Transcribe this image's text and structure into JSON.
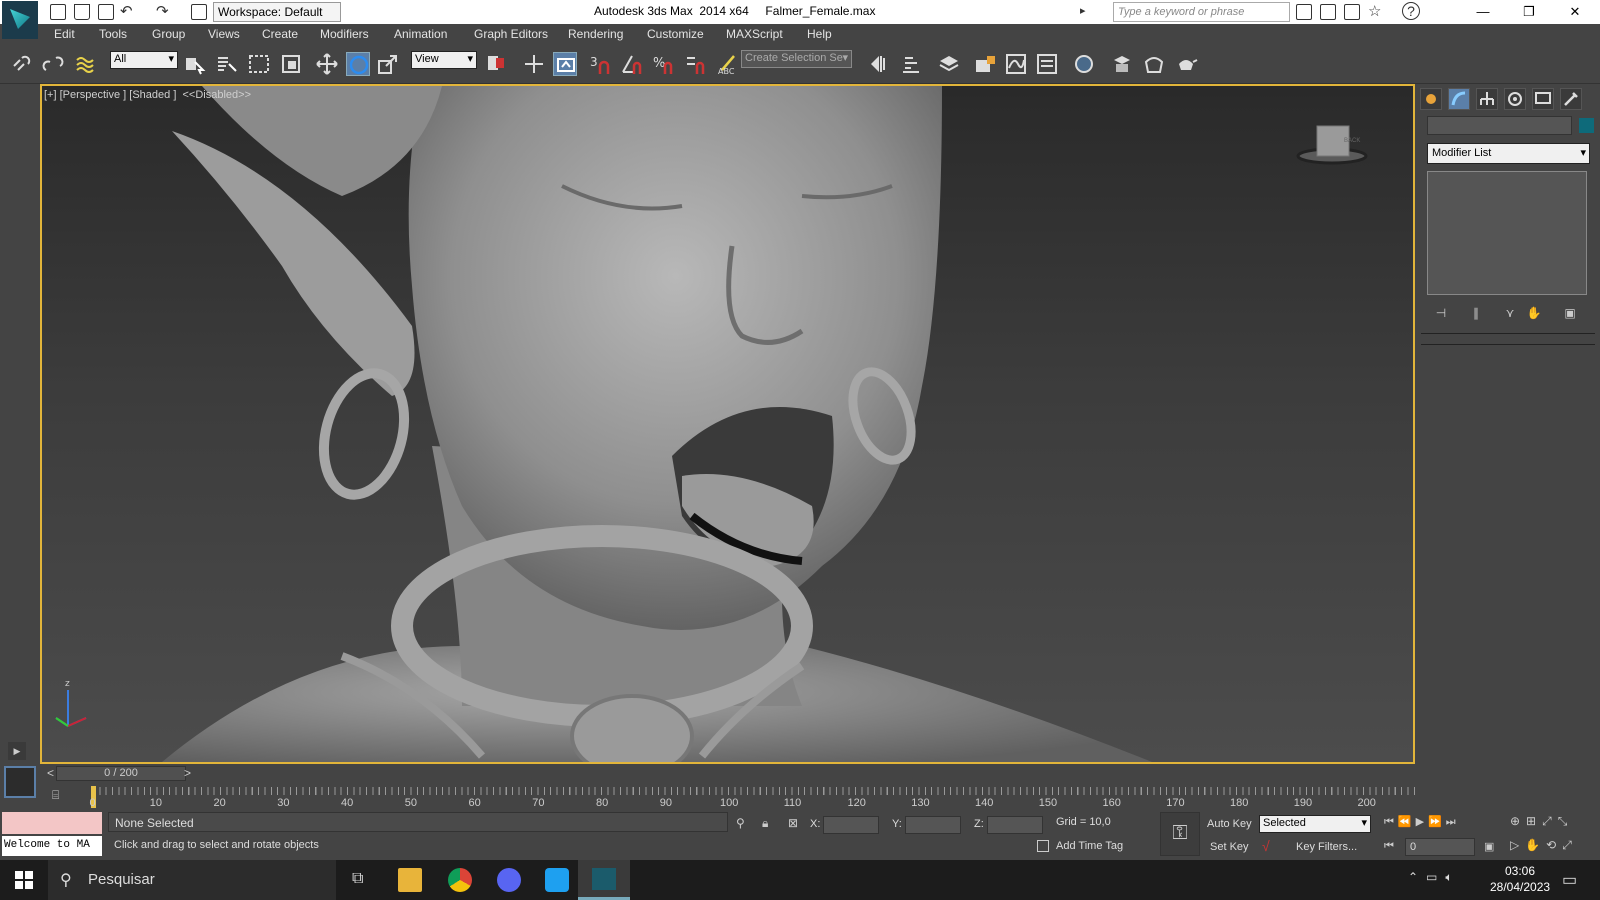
{
  "titlebar": {
    "app_title": "Autodesk 3ds Max  2014 x64     Falmer_Female.max",
    "workspace": "Workspace: Default",
    "search_placeholder": "Type a keyword or phrase",
    "minimize": "—",
    "restore": "❐",
    "close": "✕"
  },
  "menu": [
    "Edit",
    "Tools",
    "Group",
    "Views",
    "Create",
    "Modifiers",
    "Animation",
    "Graph Editors",
    "Rendering",
    "Customize",
    "MAXScript",
    "Help"
  ],
  "toolbar": {
    "filter_value": "All",
    "ref_coord_value": "View",
    "selection_set_placeholder": "Create Selection Se"
  },
  "viewport": {
    "label": "[+] [Perspective ] [Shaded ]  <<Disabled>>",
    "viewcube_label": "BACK"
  },
  "command_panel": {
    "modifier_list": "Modifier List"
  },
  "timeline": {
    "slider_label": "0 / 200",
    "ticks": [
      "0",
      "10",
      "20",
      "30",
      "40",
      "50",
      "60",
      "70",
      "80",
      "90",
      "100",
      "110",
      "120",
      "130",
      "140",
      "150",
      "160",
      "170",
      "180",
      "190",
      "200"
    ]
  },
  "status": {
    "maxscript": "Welcome to MA",
    "selection": "None Selected",
    "prompt": "Click and drag to select and rotate objects",
    "x_label": "X:",
    "y_label": "Y:",
    "z_label": "Z:",
    "grid": "Grid = 10,0",
    "add_time_tag": "Add Time Tag",
    "auto_key": "Auto Key",
    "set_key": "Set Key",
    "key_mode": "Selected",
    "key_filters": "Key Filters...",
    "frame": "0"
  },
  "taskbar": {
    "search": "Pesquisar",
    "time": "03:06",
    "date": "28/04/2023"
  },
  "colors": {
    "accent": "#e2b53a",
    "ui_bg": "#444444",
    "title_bg": "#ffffff"
  }
}
